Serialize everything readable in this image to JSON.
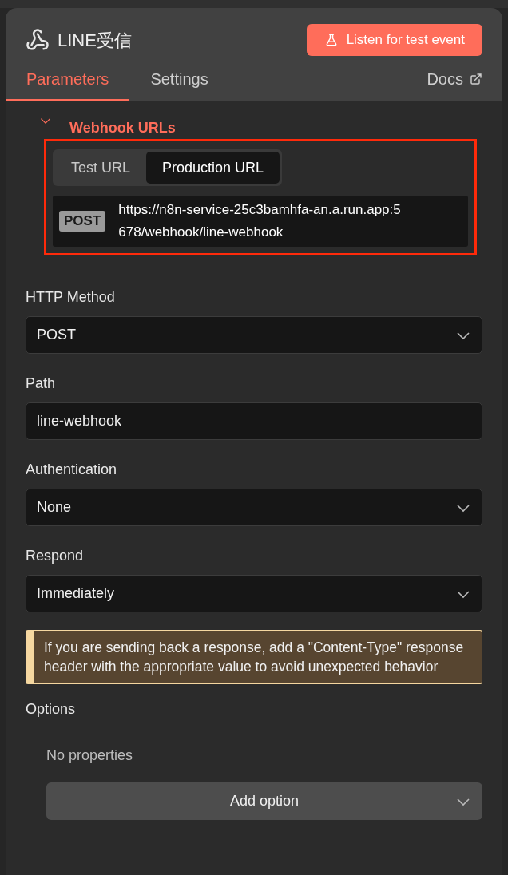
{
  "node": {
    "title": "LINE受信",
    "listen_button": "Listen for test event"
  },
  "tabs": [
    {
      "label": "Parameters",
      "selected": true
    },
    {
      "label": "Settings",
      "selected": false
    }
  ],
  "docs_link": "Docs",
  "webhook_urls": {
    "title": "Webhook URLs",
    "expanded": true,
    "highlighted": true,
    "url_tabs": [
      {
        "label": "Test URL",
        "selected": false
      },
      {
        "label": "Production URL",
        "selected": true
      }
    ],
    "method": "POST",
    "url": "https://n8n-service-25c3bamhfa-an.a.run.app:5678/webhook/line-webhook"
  },
  "fields": [
    {
      "label": "HTTP Method",
      "kind": "select",
      "value": "POST"
    },
    {
      "label": "Path",
      "kind": "input",
      "value": "line-webhook"
    },
    {
      "label": "Authentication",
      "kind": "select",
      "value": "None"
    },
    {
      "label": "Respond",
      "kind": "select",
      "value": "Immediately"
    }
  ],
  "notice": "If you are sending back a response, add a \"Content-Type\" response header with the appropriate value to avoid unexpected behavior",
  "options": {
    "title": "Options",
    "empty_text": "No properties",
    "add_button": "Add option"
  }
}
